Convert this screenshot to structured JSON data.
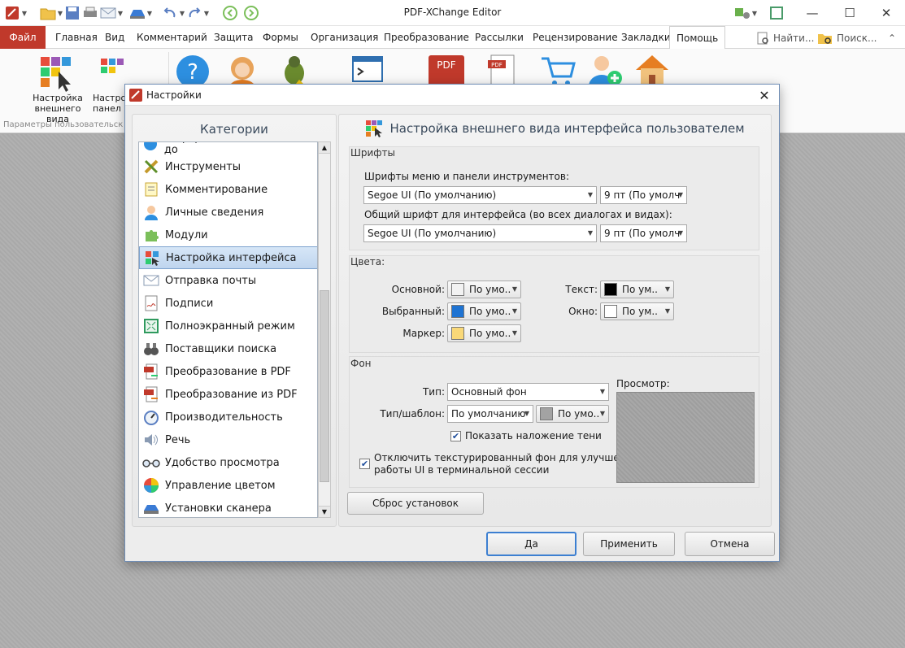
{
  "app": {
    "title": "PDF-XChange Editor"
  },
  "menu": {
    "file": "Файл",
    "tabs": [
      "Главная",
      "Вид",
      "Комментарий",
      "Защита",
      "Формы",
      "Организация",
      "Преобразование",
      "Рассылки",
      "Рецензирование",
      "Закладки",
      "Помощь"
    ],
    "active_tab": "Помощь",
    "find": "Найти...",
    "search": "Поиск..."
  },
  "ribbon": {
    "btn1_line1": "Настройка",
    "btn1_line2": "внешнего вида",
    "btn2_line1": "Настро",
    "btn2_line2": "панел",
    "group_label": "Параметры пользовательск"
  },
  "dialog": {
    "title": "Настройки",
    "categories_header": "Категории",
    "categories": [
      "Информационные панели до",
      "Инструменты",
      "Комментирование",
      "Личные сведения",
      "Модули",
      "Настройка интерфейса",
      "Отправка почты",
      "Подписи",
      "Полноэкранный режим",
      "Поставщики поиска",
      "Преобразование в PDF",
      "Преобразование из PDF",
      "Производительность",
      "Речь",
      "Удобство просмотра",
      "Управление цветом",
      "Установки сканера"
    ],
    "selected_category": "Настройка интерфейса",
    "page_title": "Настройка внешнего вида интерфейса пользователем",
    "fonts": {
      "section": "Шрифты",
      "menu_label": "Шрифты меню и панели инструментов:",
      "menu_font": "Segoe UI (По умолчанию)",
      "menu_size": "9 пт (По умолч",
      "ui_label": "Общий шрифт для интерфейса (во всех диалогах и видах):",
      "ui_font": "Segoe UI (По умолчанию)",
      "ui_size": "9 пт (По умолч"
    },
    "colors": {
      "section": "Цвета:",
      "main_label": "Основной:",
      "main_value": "По умо..",
      "main_color": "#f2f2f2",
      "selected_label": "Выбранный:",
      "selected_value": "По умо..",
      "selected_color": "#1e73d2",
      "marker_label": "Маркер:",
      "marker_value": "По умо..",
      "marker_color": "#f9d878",
      "text_label": "Текст:",
      "text_value": "По ум..",
      "text_color": "#000000",
      "window_label": "Окно:",
      "window_value": "По ум..",
      "window_color": "#ffffff"
    },
    "background": {
      "section": "Фон",
      "type_label": "Тип:",
      "type_value": "Основный фон",
      "pattern_label": "Тип/шаблон:",
      "pattern_value": "По умолчанию",
      "pattern_color_value": "По умо..",
      "pattern_color": "#a3a3a3",
      "shadow_label": "Показать наложение тени",
      "shadow_checked": true,
      "disable_texture_line1": "Отключить текстурированный фон для улучшения",
      "disable_texture_line2": "работы UI в терминальной сессии",
      "disable_texture_checked": true,
      "preview_label": "Просмотр:"
    },
    "reset_button": "Сброс установок",
    "ok_button": "Да",
    "apply_button": "Применить",
    "cancel_button": "Отмена"
  }
}
